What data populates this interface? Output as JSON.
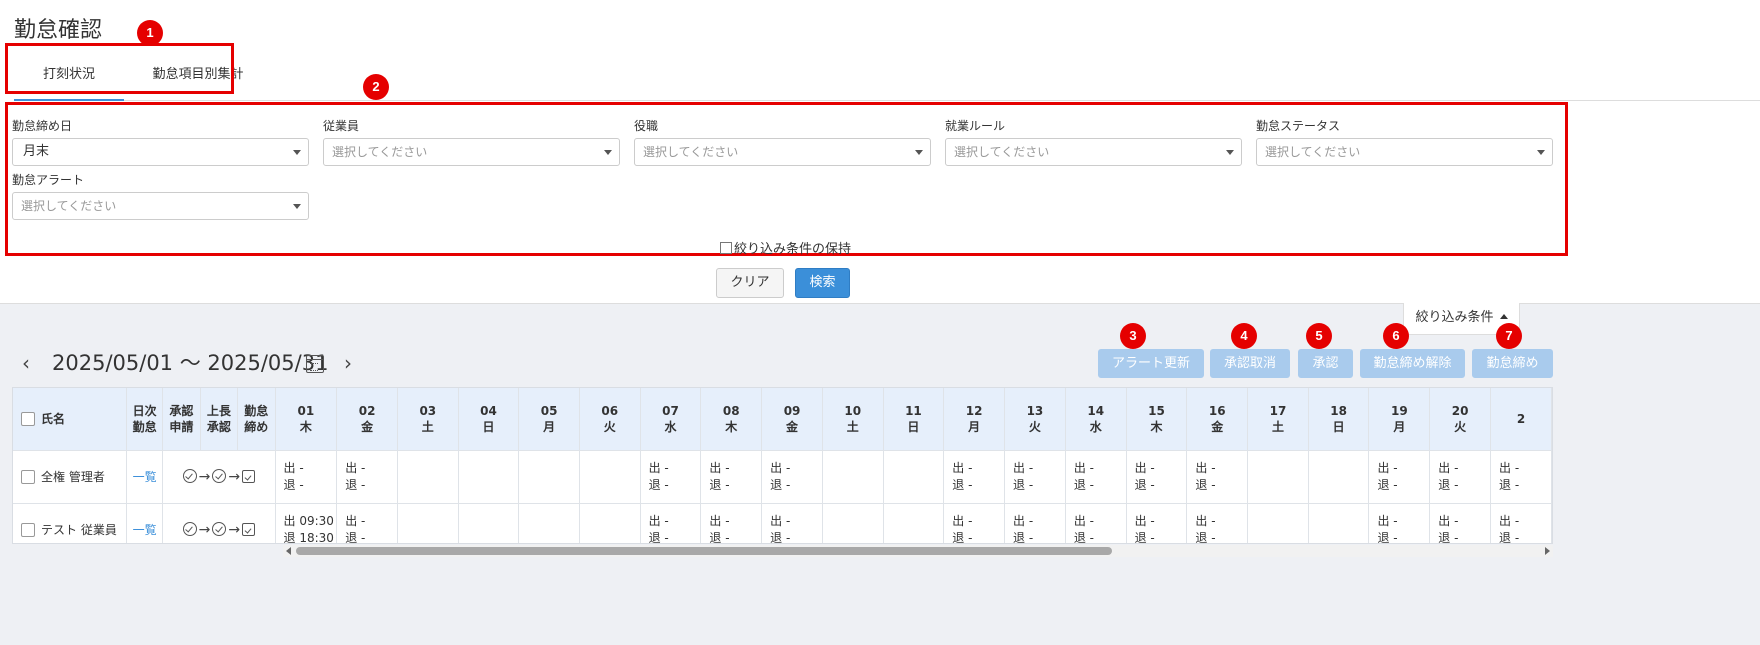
{
  "page_title": "勤怠確認",
  "tabs": [
    {
      "label": "打刻状況",
      "active": true
    },
    {
      "label": "勤怠項目別集計",
      "active": false
    }
  ],
  "filters": {
    "closing_day": {
      "label": "勤怠締め日",
      "value": "月末"
    },
    "employee": {
      "label": "従業員",
      "placeholder": "選択してください"
    },
    "position": {
      "label": "役職",
      "placeholder": "選択してください"
    },
    "work_rule": {
      "label": "就業ルール",
      "placeholder": "選択してください"
    },
    "status": {
      "label": "勤怠ステータス",
      "placeholder": "選択してください"
    },
    "alert": {
      "label": "勤怠アラート",
      "placeholder": "選択してください"
    },
    "keep_label": "絞り込み条件の保持"
  },
  "buttons": {
    "clear": "クリア",
    "search": "検索",
    "filter_toggle": "絞り込み条件"
  },
  "period": "2025/05/01 ～ 2025/05/31",
  "actions": {
    "alert_update": "アラート更新",
    "cancel_approval": "承認取消",
    "approve": "承認",
    "release_closing": "勤怠締め解除",
    "closing": "勤怠締め"
  },
  "badges": [
    "1",
    "2",
    "3",
    "4",
    "5",
    "6",
    "7"
  ],
  "table": {
    "headers": {
      "name": "氏名",
      "daily": [
        "日次",
        "勤怠"
      ],
      "approval_request": [
        "承認",
        "申請"
      ],
      "boss_approval": [
        "上長",
        "承認"
      ],
      "closing": [
        "勤怠",
        "締め"
      ]
    },
    "days": [
      {
        "d": "01",
        "w": "木"
      },
      {
        "d": "02",
        "w": "金"
      },
      {
        "d": "03",
        "w": "土"
      },
      {
        "d": "04",
        "w": "日"
      },
      {
        "d": "05",
        "w": "月"
      },
      {
        "d": "06",
        "w": "火"
      },
      {
        "d": "07",
        "w": "水"
      },
      {
        "d": "08",
        "w": "木"
      },
      {
        "d": "09",
        "w": "金"
      },
      {
        "d": "10",
        "w": "土"
      },
      {
        "d": "11",
        "w": "日"
      },
      {
        "d": "12",
        "w": "月"
      },
      {
        "d": "13",
        "w": "火"
      },
      {
        "d": "14",
        "w": "水"
      },
      {
        "d": "15",
        "w": "木"
      },
      {
        "d": "16",
        "w": "金"
      },
      {
        "d": "17",
        "w": "土"
      },
      {
        "d": "18",
        "w": "日"
      },
      {
        "d": "19",
        "w": "月"
      },
      {
        "d": "20",
        "w": "火"
      },
      {
        "d": "2",
        "w": ""
      }
    ],
    "link_label": "一覧",
    "rows": [
      {
        "name": "全権 管理者",
        "cells": [
          "出 -|退 -",
          "出 -|退 -",
          "",
          "",
          "",
          "",
          "出 -|退 -",
          "出 -|退 -",
          "出 -|退 -",
          "",
          "",
          "出 -|退 -",
          "出 -|退 -",
          "出 -|退 -",
          "出 -|退 -",
          "出 -|退 -",
          "",
          "",
          "出 -|退 -",
          "出 -|退 -",
          "出 -|退 -"
        ]
      },
      {
        "name": "テスト 従業員",
        "cells": [
          "出 09:30|退 18:30",
          "出 -|退 -",
          "",
          "",
          "",
          "",
          "出 -|退 -",
          "出 -|退 -",
          "出 -|退 -",
          "",
          "",
          "出 -|退 -",
          "出 -|退 -",
          "出 -|退 -",
          "出 -|退 -",
          "出 -|退 -",
          "",
          "",
          "出 -|退 -",
          "出 -|退 -",
          "出 -|退 -"
        ]
      }
    ]
  }
}
